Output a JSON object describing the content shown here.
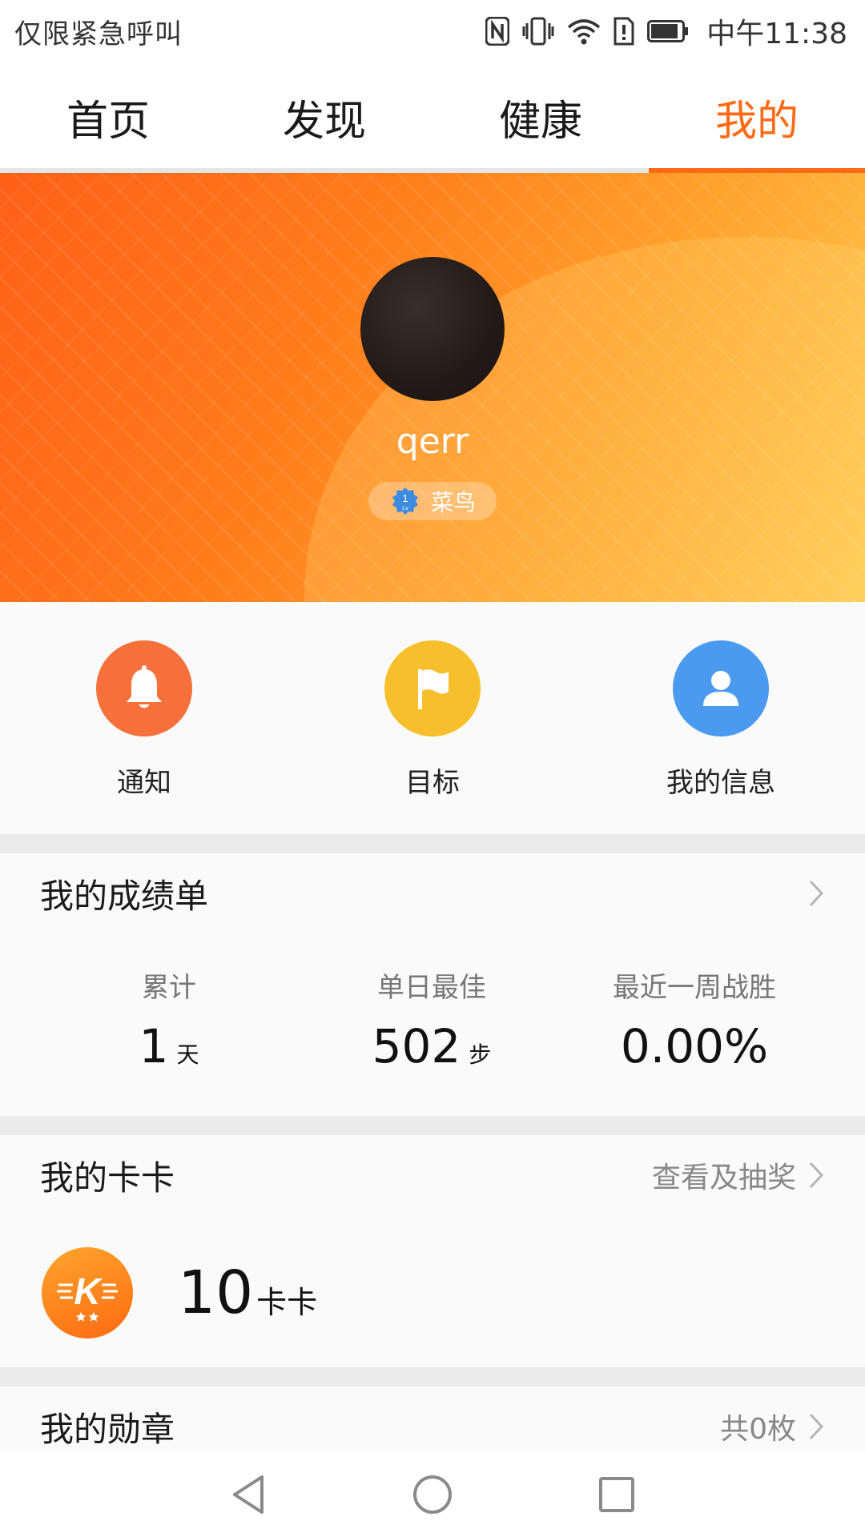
{
  "status_bar": {
    "carrier_text": "仅限紧急呼叫",
    "time": "中午11:38",
    "icons": [
      "nfc-icon",
      "vibrate-icon",
      "wifi-icon",
      "sim-alert-icon",
      "battery-icon"
    ]
  },
  "tabs": [
    {
      "label": "首页",
      "active": false
    },
    {
      "label": "发现",
      "active": false
    },
    {
      "label": "健康",
      "active": false
    },
    {
      "label": "我的",
      "active": true
    }
  ],
  "profile": {
    "username": "qerr",
    "level_number": "1",
    "level_prefix": "Lv",
    "level_title": "菜鸟"
  },
  "shortcuts": [
    {
      "label": "通知",
      "icon": "bell-icon",
      "color": "#f5703a"
    },
    {
      "label": "目标",
      "icon": "flag-icon",
      "color": "#f7bf2c"
    },
    {
      "label": "我的信息",
      "icon": "person-icon",
      "color": "#4a9bf0"
    }
  ],
  "report_card": {
    "title": "我的成绩单",
    "stats": [
      {
        "label": "累计",
        "value": "1",
        "unit": "天"
      },
      {
        "label": "单日最佳",
        "value": "502",
        "unit": "步"
      },
      {
        "label": "最近一周战胜",
        "value": "0.00%",
        "unit": ""
      }
    ]
  },
  "kaka": {
    "title": "我的卡卡",
    "link": "查看及抽奖",
    "value": "10",
    "unit": "卡卡",
    "logo_letter": "K"
  },
  "medals": {
    "title": "我的勋章",
    "count_text": "共0枚"
  },
  "colors": {
    "accent": "#ff6a13",
    "hero_start": "#ff6018",
    "hero_end": "#ffcb52"
  }
}
